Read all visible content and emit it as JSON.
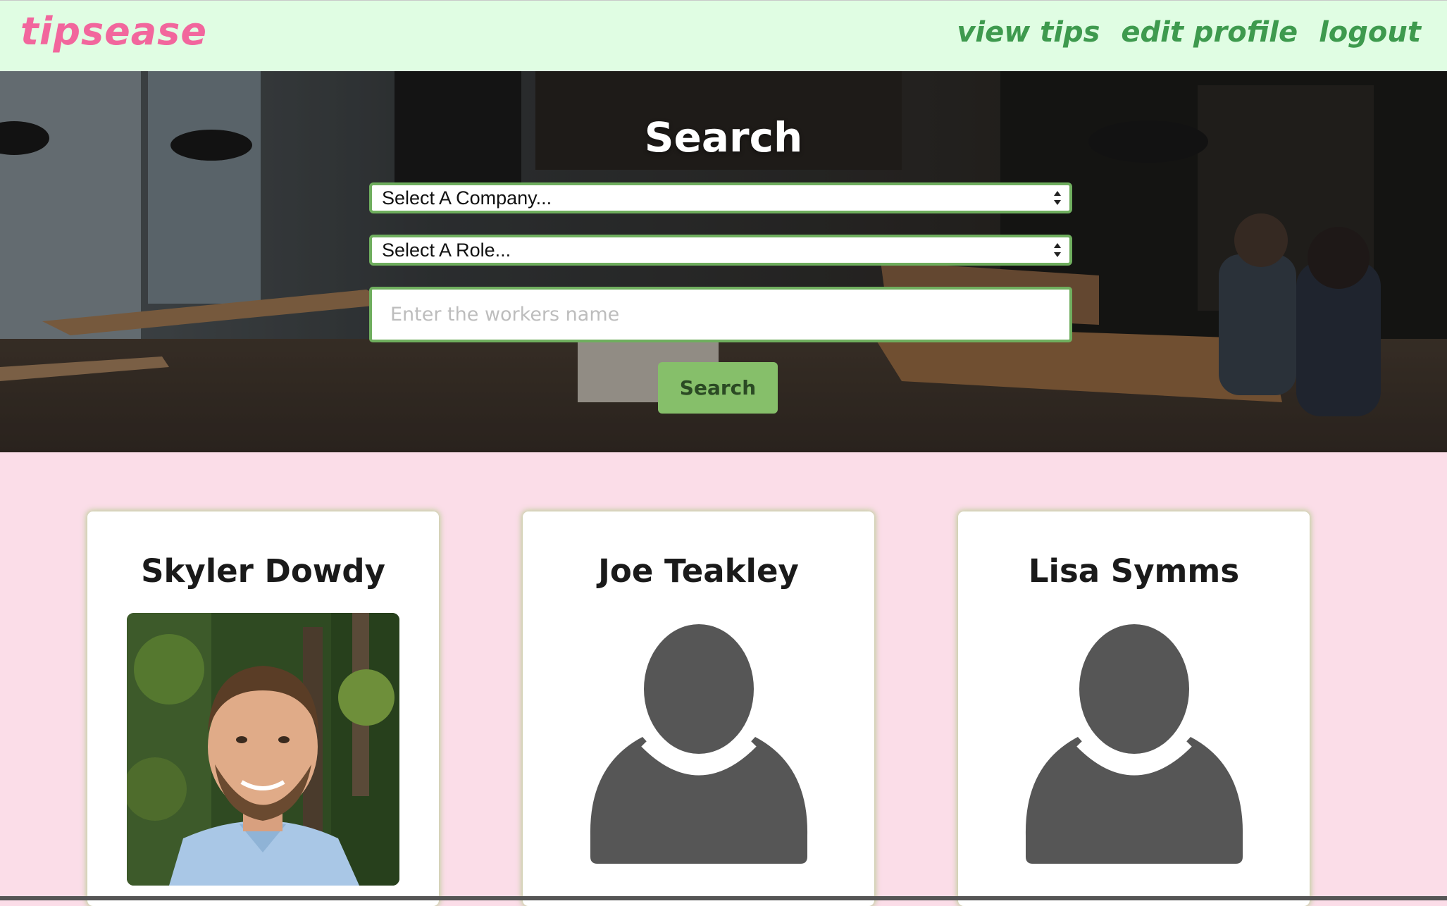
{
  "header": {
    "logo": "tipsease",
    "nav": [
      {
        "label": "view tips"
      },
      {
        "label": "edit profile"
      },
      {
        "label": "logout"
      }
    ]
  },
  "search": {
    "title": "Search",
    "company_select": "Select A Company...",
    "role_select": "Select A Role...",
    "name_placeholder": "Enter the workers name",
    "button_label": "Search"
  },
  "workers": [
    {
      "name": "Skyler Dowdy",
      "photo": "person-photo"
    },
    {
      "name": "Joe Teakley",
      "photo": "default-avatar-icon"
    },
    {
      "name": "Lisa Symms",
      "photo": "default-avatar-icon"
    }
  ],
  "colors": {
    "nav_bg": "#e0fde3",
    "logo": "#f2669d",
    "nav_link": "#3e9a4e",
    "page_bg": "#fbdde8",
    "accent_green": "#6fae5e",
    "button_bg": "#86bf6a",
    "avatar_gray": "#565656"
  }
}
